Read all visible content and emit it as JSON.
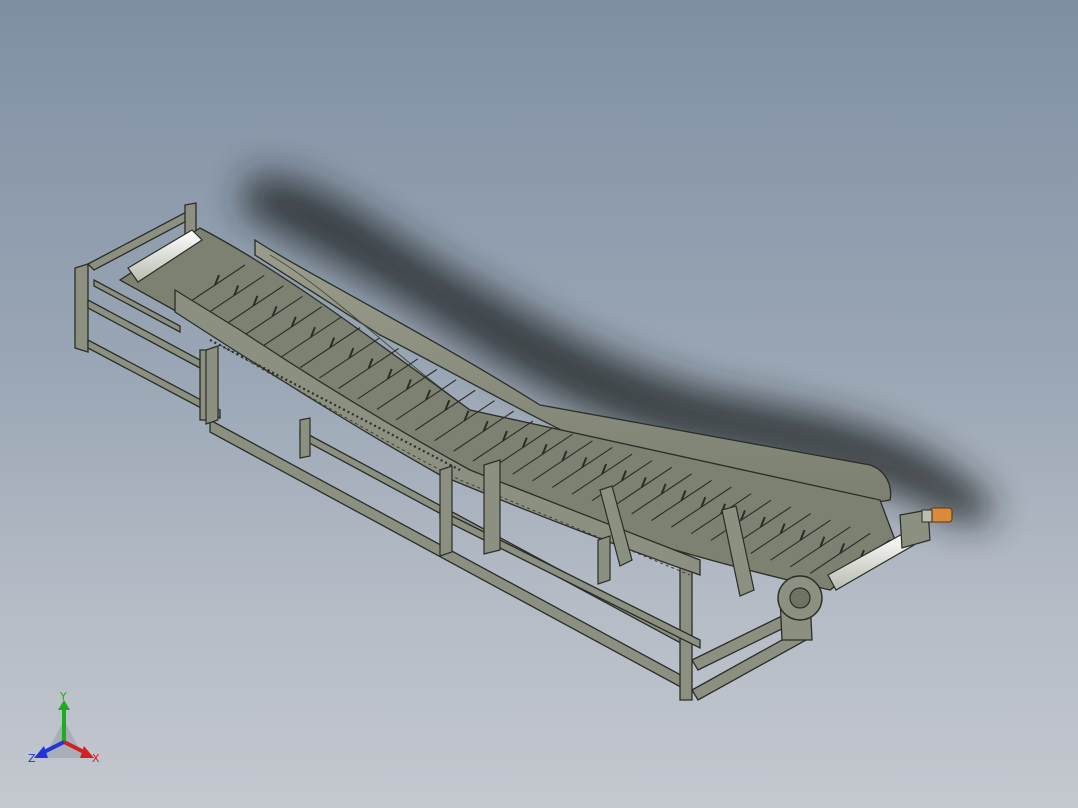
{
  "viewport": {
    "background_top": "#7f8fa3",
    "background_bottom": "#c4c8cf",
    "model_color": "#8c9081",
    "edge_color": "#2b2d28"
  },
  "triad": {
    "x_label": "X",
    "y_label": "Y",
    "z_label": "Z",
    "x_color": "#d42020",
    "y_color": "#1cae1c",
    "z_color": "#2236d8"
  }
}
